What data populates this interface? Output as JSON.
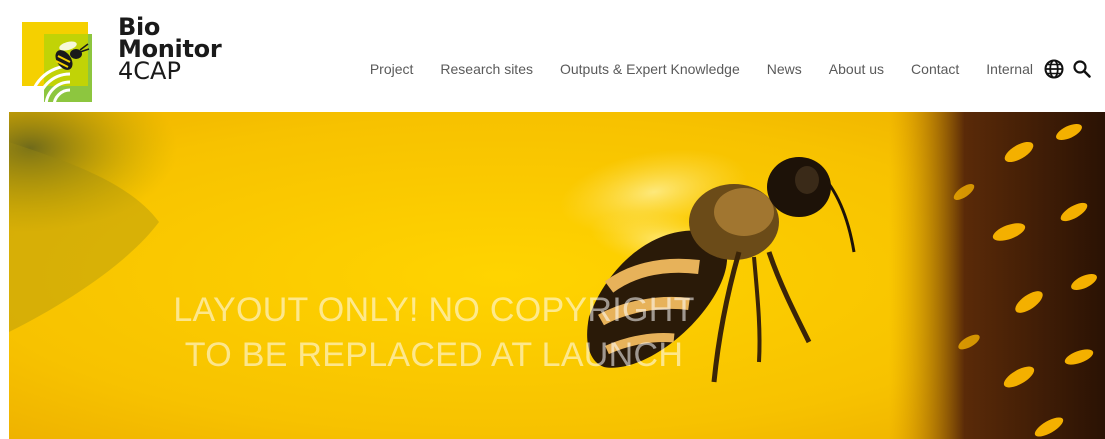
{
  "brand": {
    "line1": "Bio",
    "line2": "Monitor",
    "line3": "4CAP",
    "colors": {
      "yellow": "#f5d000",
      "green": "#8dc63f",
      "dark": "#1a1a1a"
    }
  },
  "nav": {
    "items": [
      {
        "label": "Project"
      },
      {
        "label": "Research sites"
      },
      {
        "label": "Outputs & Expert Knowledge"
      },
      {
        "label": "News"
      },
      {
        "label": "About us"
      },
      {
        "label": "Contact"
      },
      {
        "label": "Internal"
      }
    ],
    "icons": [
      "globe-icon",
      "search-icon"
    ]
  },
  "hero": {
    "overlay_line1": "LAYOUT ONLY! NO COPYRIGHT",
    "overlay_line2": "TO BE REPLACED AT LAUNCH",
    "image": "bee-on-sunflower"
  }
}
